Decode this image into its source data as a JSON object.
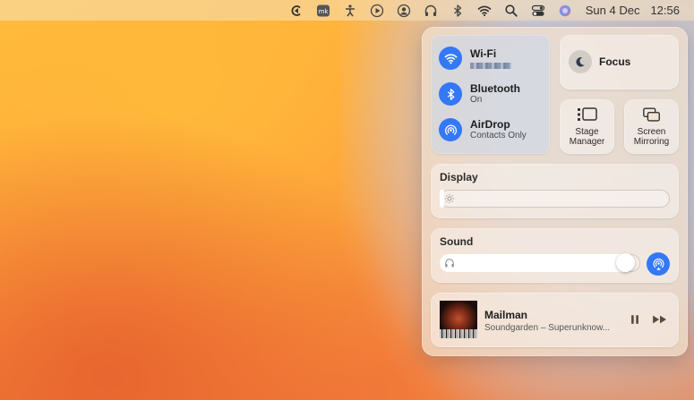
{
  "menubar": {
    "icons": [
      "app-c-icon",
      "mk-app-icon",
      "accessibility-icon",
      "play-circle-icon",
      "user-circle-icon",
      "headphones-icon",
      "bluetooth-icon",
      "wifi-icon",
      "search-icon",
      "control-center-icon",
      "siri-icon"
    ],
    "date": "Sun 4 Dec",
    "time": "12:56"
  },
  "control_center": {
    "network": {
      "wifi": {
        "title": "Wi-Fi",
        "icon": "wifi-icon"
      },
      "bluetooth": {
        "title": "Bluetooth",
        "status": "On",
        "icon": "bluetooth-icon"
      },
      "airdrop": {
        "title": "AirDrop",
        "status": "Contacts Only",
        "icon": "airdrop-icon"
      }
    },
    "focus": {
      "label": "Focus",
      "icon": "moon-icon"
    },
    "stage_manager": {
      "label_line1": "Stage",
      "label_line2": "Manager",
      "icon": "stage-manager-icon"
    },
    "screen_mirroring": {
      "label_line1": "Screen",
      "label_line2": "Mirroring",
      "icon": "screen-mirroring-icon"
    },
    "display": {
      "label": "Display",
      "brightness": 0.02,
      "icon": "sun-icon"
    },
    "sound": {
      "label": "Sound",
      "volume": 0.97,
      "icon": "headphones-icon",
      "output_icon": "airplay-icon"
    },
    "now_playing": {
      "title": "Mailman",
      "subtitle": "Soundgarden – Superunknow...",
      "controls": [
        "pause-icon",
        "forward-icon"
      ]
    }
  },
  "colors": {
    "accent": "#3478f6"
  }
}
